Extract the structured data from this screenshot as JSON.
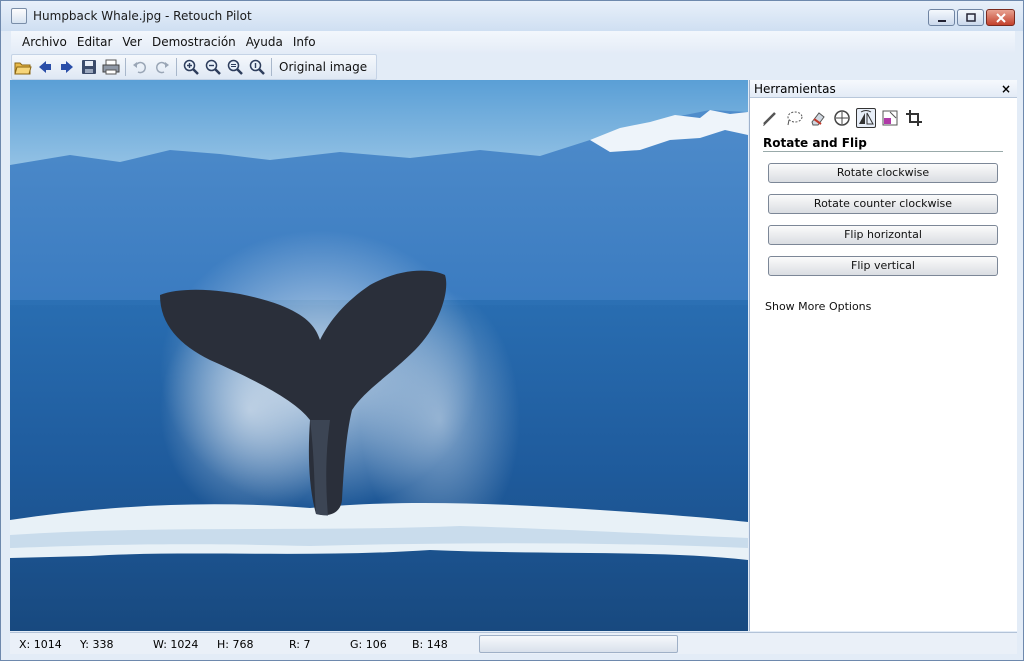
{
  "window": {
    "title": "Humpback Whale.jpg - Retouch Pilot",
    "buttons": [
      "minimize",
      "maximize",
      "close"
    ]
  },
  "menu": [
    "Archivo",
    "Editar",
    "Ver",
    "Demostración",
    "Ayuda",
    "Info"
  ],
  "toolbar": {
    "icons": [
      "open-icon",
      "back-arrow-icon",
      "forward-arrow-icon",
      "save-icon",
      "print-icon",
      "undo-icon",
      "redo-icon",
      "zoom-in-icon",
      "zoom-out-icon",
      "zoom-fit-icon",
      "zoom-actual-icon"
    ],
    "original_image_label": "Original image"
  },
  "panel": {
    "title": "Herramientas",
    "close": "×",
    "tools": [
      "pencil-icon",
      "lasso-icon",
      "eraser-icon",
      "clone-icon",
      "rotate-flip-icon",
      "color-icon",
      "crop-icon"
    ],
    "active_tool": "rotate-flip-icon",
    "section_title": "Rotate and Flip",
    "buttons": [
      "Rotate clockwise",
      "Rotate counter clockwise",
      "Flip horizontal",
      "Flip vertical"
    ],
    "more_options": "Show More Options"
  },
  "status": {
    "x": "X: 1014",
    "y": "Y: 338",
    "w": "W: 1024",
    "h": "H: 768",
    "r": "R: 7",
    "g": "G: 106",
    "b": "B: 148"
  },
  "colors": {
    "sky": "#8fbfe2",
    "sea": "#1f5c9e",
    "whale_tail": "#2a2f3a",
    "foam": "#e8f1f7"
  }
}
